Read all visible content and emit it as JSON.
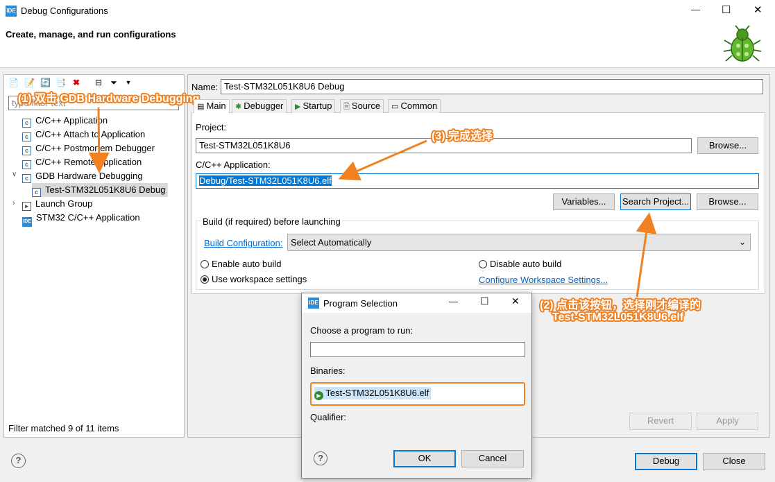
{
  "window": {
    "title": "Debug Configurations",
    "header": "Create, manage, and run configurations",
    "min": "—",
    "max": "☐",
    "close": "✕"
  },
  "left": {
    "filter_placeholder": "type filter text",
    "tree": [
      {
        "label": "C/C++ Application"
      },
      {
        "label": "C/C++ Attach to Application"
      },
      {
        "label": "C/C++ Postmortem Debugger"
      },
      {
        "label": "C/C++ Remote Application"
      },
      {
        "label": "GDB Hardware Debugging"
      },
      {
        "label": "Test-STM32L051K8U6 Debug"
      },
      {
        "label": "Launch Group"
      },
      {
        "label": "STM32 C/C++ Application"
      }
    ],
    "status": "Filter matched 9 of 11 items"
  },
  "right": {
    "name_label": "Name:",
    "name_value": "Test-STM32L051K8U6 Debug",
    "tabs": [
      "Main",
      "Debugger",
      "Startup",
      "Source",
      "Common"
    ],
    "project_label": "Project:",
    "project_value": "Test-STM32L051K8U6",
    "browse1": "Browse...",
    "app_label": "C/C++ Application:",
    "app_value": "Debug/Test-STM32L051K8U6.elf",
    "variables": "Variables...",
    "search_project": "Search Project...",
    "browse2": "Browse...",
    "build_group": "Build (if required) before launching",
    "build_config_link": "Build Configuration:",
    "build_config_value": "Select Automatically",
    "enable_auto": "Enable auto build",
    "disable_auto": "Disable auto build",
    "use_workspace": "Use workspace settings",
    "configure_ws": "Configure Workspace Settings...",
    "revert": "Revert",
    "apply": "Apply"
  },
  "footer": {
    "help": "?",
    "debug": "Debug",
    "close": "Close"
  },
  "dialog": {
    "title": "Program Selection",
    "min": "—",
    "max": "☐",
    "close": "✕",
    "choose_label": "Choose a program to run:",
    "filter_value": "",
    "binaries_label": "Binaries:",
    "binary_item": "Test-STM32L051K8U6.elf",
    "qualifier_label": "Qualifier:",
    "ok": "OK",
    "cancel": "Cancel",
    "help": "?"
  },
  "annotations": {
    "a1": "(1) 双击 GDB Hardware Debugging",
    "a2_line1": "(2) 点击该按钮，选择刚才编译的",
    "a2_line2": "Test-STM32L051K8U6.elf",
    "a3": "(3) 完成选择"
  },
  "colors": {
    "accent": "#0078d7",
    "annotation": "#f08020",
    "selection": "#0078d7",
    "link": "#0066cc"
  }
}
